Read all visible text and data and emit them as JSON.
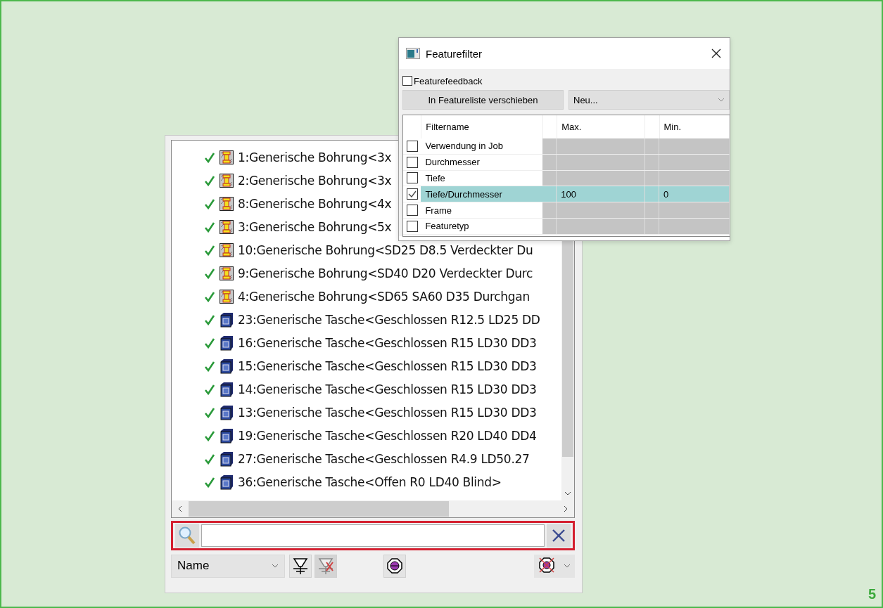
{
  "feature_list": {
    "items": [
      {
        "kind": "hole",
        "checked": true,
        "label": "1:Generische Bohrung<3x"
      },
      {
        "kind": "hole",
        "checked": true,
        "label": "2:Generische Bohrung<3x"
      },
      {
        "kind": "hole",
        "checked": true,
        "label": "8:Generische Bohrung<4x"
      },
      {
        "kind": "hole",
        "checked": true,
        "label": "3:Generische Bohrung<5x"
      },
      {
        "kind": "hole",
        "checked": true,
        "label": "10:Generische Bohrung<SD25 D8.5 Verdeckter Du"
      },
      {
        "kind": "hole",
        "checked": true,
        "label": "9:Generische Bohrung<SD40 D20 Verdeckter Durc"
      },
      {
        "kind": "hole",
        "checked": true,
        "label": "4:Generische Bohrung<SD65 SA60 D35 Durchgan"
      },
      {
        "kind": "pocket",
        "checked": true,
        "label": "23:Generische Tasche<Geschlossen R12.5 LD25 DD"
      },
      {
        "kind": "pocket",
        "checked": true,
        "label": "16:Generische Tasche<Geschlossen R15 LD30 DD3"
      },
      {
        "kind": "pocket",
        "checked": true,
        "label": "15:Generische Tasche<Geschlossen R15 LD30 DD3"
      },
      {
        "kind": "pocket",
        "checked": true,
        "label": "14:Generische Tasche<Geschlossen R15 LD30 DD3"
      },
      {
        "kind": "pocket",
        "checked": true,
        "label": "13:Generische Tasche<Geschlossen R15 LD30 DD3"
      },
      {
        "kind": "pocket",
        "checked": true,
        "label": "19:Generische Tasche<Geschlossen R20 LD40 DD4"
      },
      {
        "kind": "pocket",
        "checked": true,
        "label": "27:Generische Tasche<Geschlossen R4.9 LD50.27"
      },
      {
        "kind": "pocket",
        "checked": true,
        "label": "36:Generische Tasche<Offen R0 LD40 Blind>"
      }
    ],
    "sort_dropdown": {
      "value": "Name"
    }
  },
  "dialog": {
    "title": "Featurefilter",
    "feedback_checkbox": {
      "label": "Featurefeedback",
      "checked": false
    },
    "move_button": "In Featureliste verschieben",
    "preset_dropdown": {
      "value": "Neu..."
    },
    "columns": [
      "Filtername",
      "Max.",
      "Min."
    ],
    "rows": [
      {
        "name": "Verwendung in Job",
        "checked": false,
        "selected": false
      },
      {
        "name": "Durchmesser",
        "checked": false,
        "selected": false
      },
      {
        "name": "Tiefe",
        "checked": false,
        "selected": false
      },
      {
        "name": "Tiefe/Durchmesser",
        "checked": true,
        "selected": true,
        "max": "100",
        "min": "0"
      },
      {
        "name": "Frame",
        "checked": false,
        "selected": false
      },
      {
        "name": "Featuretyp",
        "checked": false,
        "selected": false
      }
    ]
  },
  "figure_number": "5"
}
